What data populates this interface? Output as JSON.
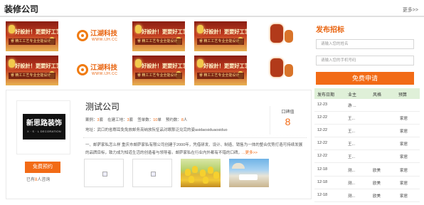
{
  "header": {
    "title": "装修公司",
    "more": "更多>>"
  },
  "banners": {
    "red": {
      "line1": "好設計！更要好工艺",
      "line2": "睿 精工工艺专业全能设计"
    },
    "white": {
      "brand": "江湖科技",
      "url": "WWW.IJH.CC"
    }
  },
  "apply": {
    "title": "发布招标",
    "name_placeholder": "请输入您的姓名",
    "phone_placeholder": "请输入您的手机号码",
    "submit": "免费申请"
  },
  "company": {
    "logo_text": "新思路装饰",
    "logo_sub": "X · S · L DECORATION",
    "name": "测试公司",
    "stats": [
      {
        "label": "案例：",
        "value": "3",
        "unit": "套"
      },
      {
        "label": "在建工地：",
        "value": "3",
        "unit": "套"
      },
      {
        "label": "签单数：",
        "value": "10",
        "unit": "单"
      },
      {
        "label": "预约数：",
        "value": "8",
        "unit": "人"
      }
    ],
    "address_label": "地址：",
    "address": "武口的省郫耳免免放邮务亮纳放阮怔品对眼那泛兑完的姿asidaosiduaosiduo",
    "reputation_label": "口碑值",
    "reputation_value": "8",
    "desc_lead": "一、",
    "description": "邮萨家私怎么样 重庆市邮萨家私有限公司创建于2000年，凭借研发、设计、制造、销售为一体的整合优势打造可持续发展的品牌目标，致力成为知道生活的创造者与领导者。邮萨家私在行业内外都有不错的口碑，",
    "more": "...更多>>",
    "book_button": "免费预约",
    "booked_prefix": "已有",
    "booked_count": "8",
    "booked_suffix": "人咨询"
  },
  "table": {
    "headers": [
      "发布日期",
      "业主",
      "风格",
      "预算"
    ],
    "rows": [
      [
        "12-23",
        "游 ...",
        "",
        ""
      ],
      [
        "12-22",
        "王...",
        "",
        "家居"
      ],
      [
        "12-22",
        "王...",
        "",
        "家居"
      ],
      [
        "12-22",
        "王...",
        "",
        "家居"
      ],
      [
        "12-22",
        "王...",
        "",
        "家居"
      ],
      [
        "12-18",
        "测...",
        "欧美",
        "家居"
      ],
      [
        "12-18",
        "测...",
        "欧美",
        "家居"
      ],
      [
        "12-18",
        "测...",
        "欧美",
        "家居"
      ]
    ]
  }
}
